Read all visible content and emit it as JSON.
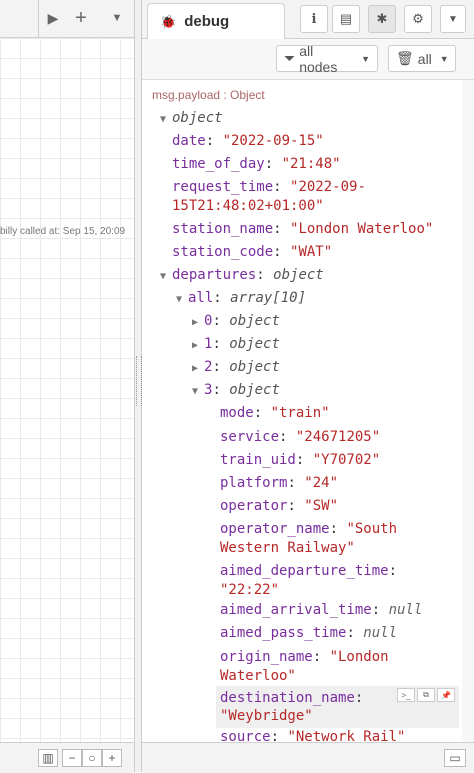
{
  "workspace": {
    "flow_note": "billy called at: Sep 15, 20:09",
    "toolbar": {
      "play_icon": "play-icon",
      "add_icon": "plus-icon",
      "menu_icon": "caret-down-icon"
    }
  },
  "sidebar": {
    "tab_label": "debug",
    "buttons": [
      "info-icon",
      "book-icon",
      "bug-icon",
      "gear-icon"
    ],
    "filter": {
      "nodes_label": "all nodes",
      "clear_label": "all"
    },
    "message": {
      "meta": "msg.payload : Object",
      "root_type": "object",
      "date_key": "date",
      "date_val": "\"2022-09-15\"",
      "tod_key": "time_of_day",
      "tod_val": "\"21:48\"",
      "req_key": "request_time",
      "req_val1": "\"2022-09-",
      "req_val2": "15T21:48:02+01:00\"",
      "sname_key": "station_name",
      "sname_val": "\"London Waterloo\"",
      "scode_key": "station_code",
      "scode_val": "\"WAT\"",
      "departures_key": "departures",
      "departures_type": "object",
      "all_key": "all",
      "all_type": "array[10]",
      "item0_key": "0",
      "item0_type": "object",
      "item1_key": "1",
      "item1_type": "object",
      "item2_key": "2",
      "item2_type": "object",
      "item3_key": "3",
      "item3_type": "object",
      "mode_key": "mode",
      "mode_val": "\"train\"",
      "service_key": "service",
      "service_val": "\"24671205\"",
      "uid_key": "train_uid",
      "uid_val": "\"Y70702\"",
      "platform_key": "platform",
      "platform_val": "\"24\"",
      "operator_key": "operator",
      "operator_val": "\"SW\"",
      "opname_key": "operator_name",
      "opname_val1": "\"South",
      "opname_val2": "Western Railway\"",
      "adep_key": "aimed_departure_time",
      "adep_val": "\"22:22\"",
      "aarr_key": "aimed_arrival_time",
      "aarr_val": "null",
      "apass_key": "aimed_pass_time",
      "apass_val": "null",
      "origin_key": "origin_name",
      "origin_val1": "\"London",
      "origin_val2": "Waterloo\"",
      "dest_key": "destination_name",
      "dest_val": "\"Weybridge\"",
      "source_key": "source",
      "source_val": "\"Network Rail\""
    }
  }
}
